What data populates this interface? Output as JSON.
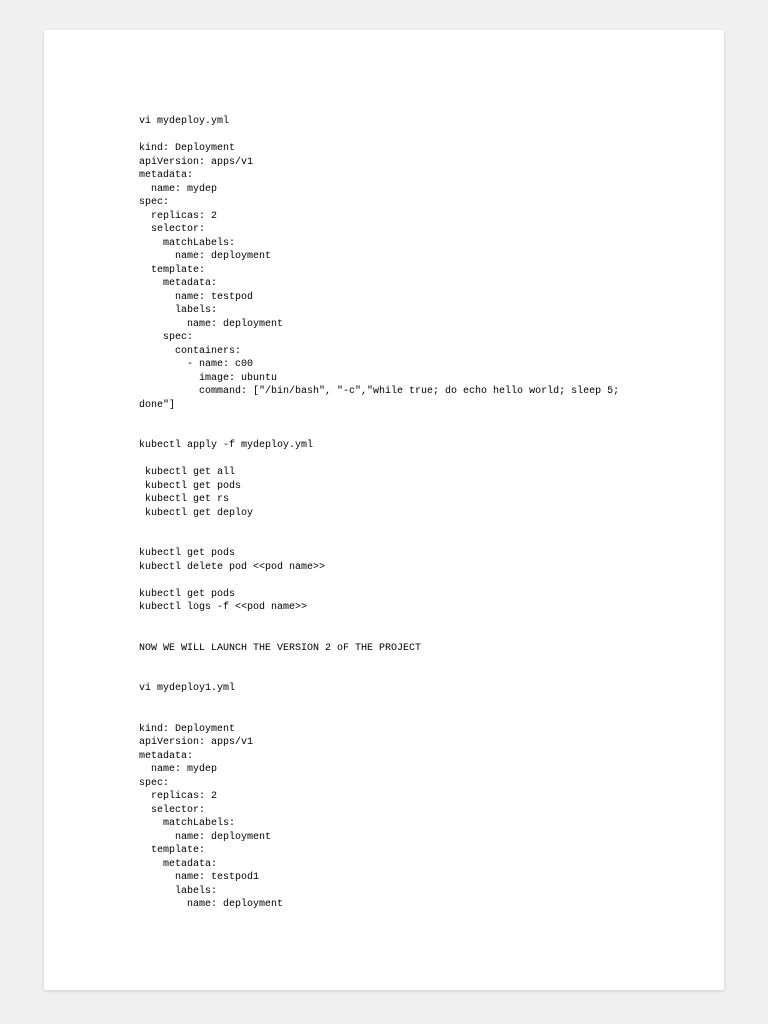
{
  "content": "vi mydeploy.yml\n\nkind: Deployment\napiVersion: apps/v1\nmetadata:\n  name: mydep\nspec:\n  replicas: 2\n  selector:\n    matchLabels:\n      name: deployment\n  template:\n    metadata:\n      name: testpod\n      labels:\n        name: deployment\n    spec:\n      containers:\n        - name: c00\n          image: ubuntu\n          command: [\"/bin/bash\", \"-c\",\"while true; do echo hello world; sleep 5;\ndone\"]\n\n\nkubectl apply -f mydeploy.yml\n\n kubectl get all\n kubectl get pods\n kubectl get rs\n kubectl get deploy\n\n\nkubectl get pods\nkubectl delete pod <<pod name>>\n\nkubectl get pods\nkubectl logs -f <<pod name>>\n\n\nNOW WE WILL LAUNCH THE VERSION 2 oF THE PROJECT\n\n\nvi mydeploy1.yml\n\n\nkind: Deployment\napiVersion: apps/v1\nmetadata:\n  name: mydep\nspec:\n  replicas: 2\n  selector:\n    matchLabels:\n      name: deployment\n  template:\n    metadata:\n      name: testpod1\n      labels:\n        name: deployment"
}
